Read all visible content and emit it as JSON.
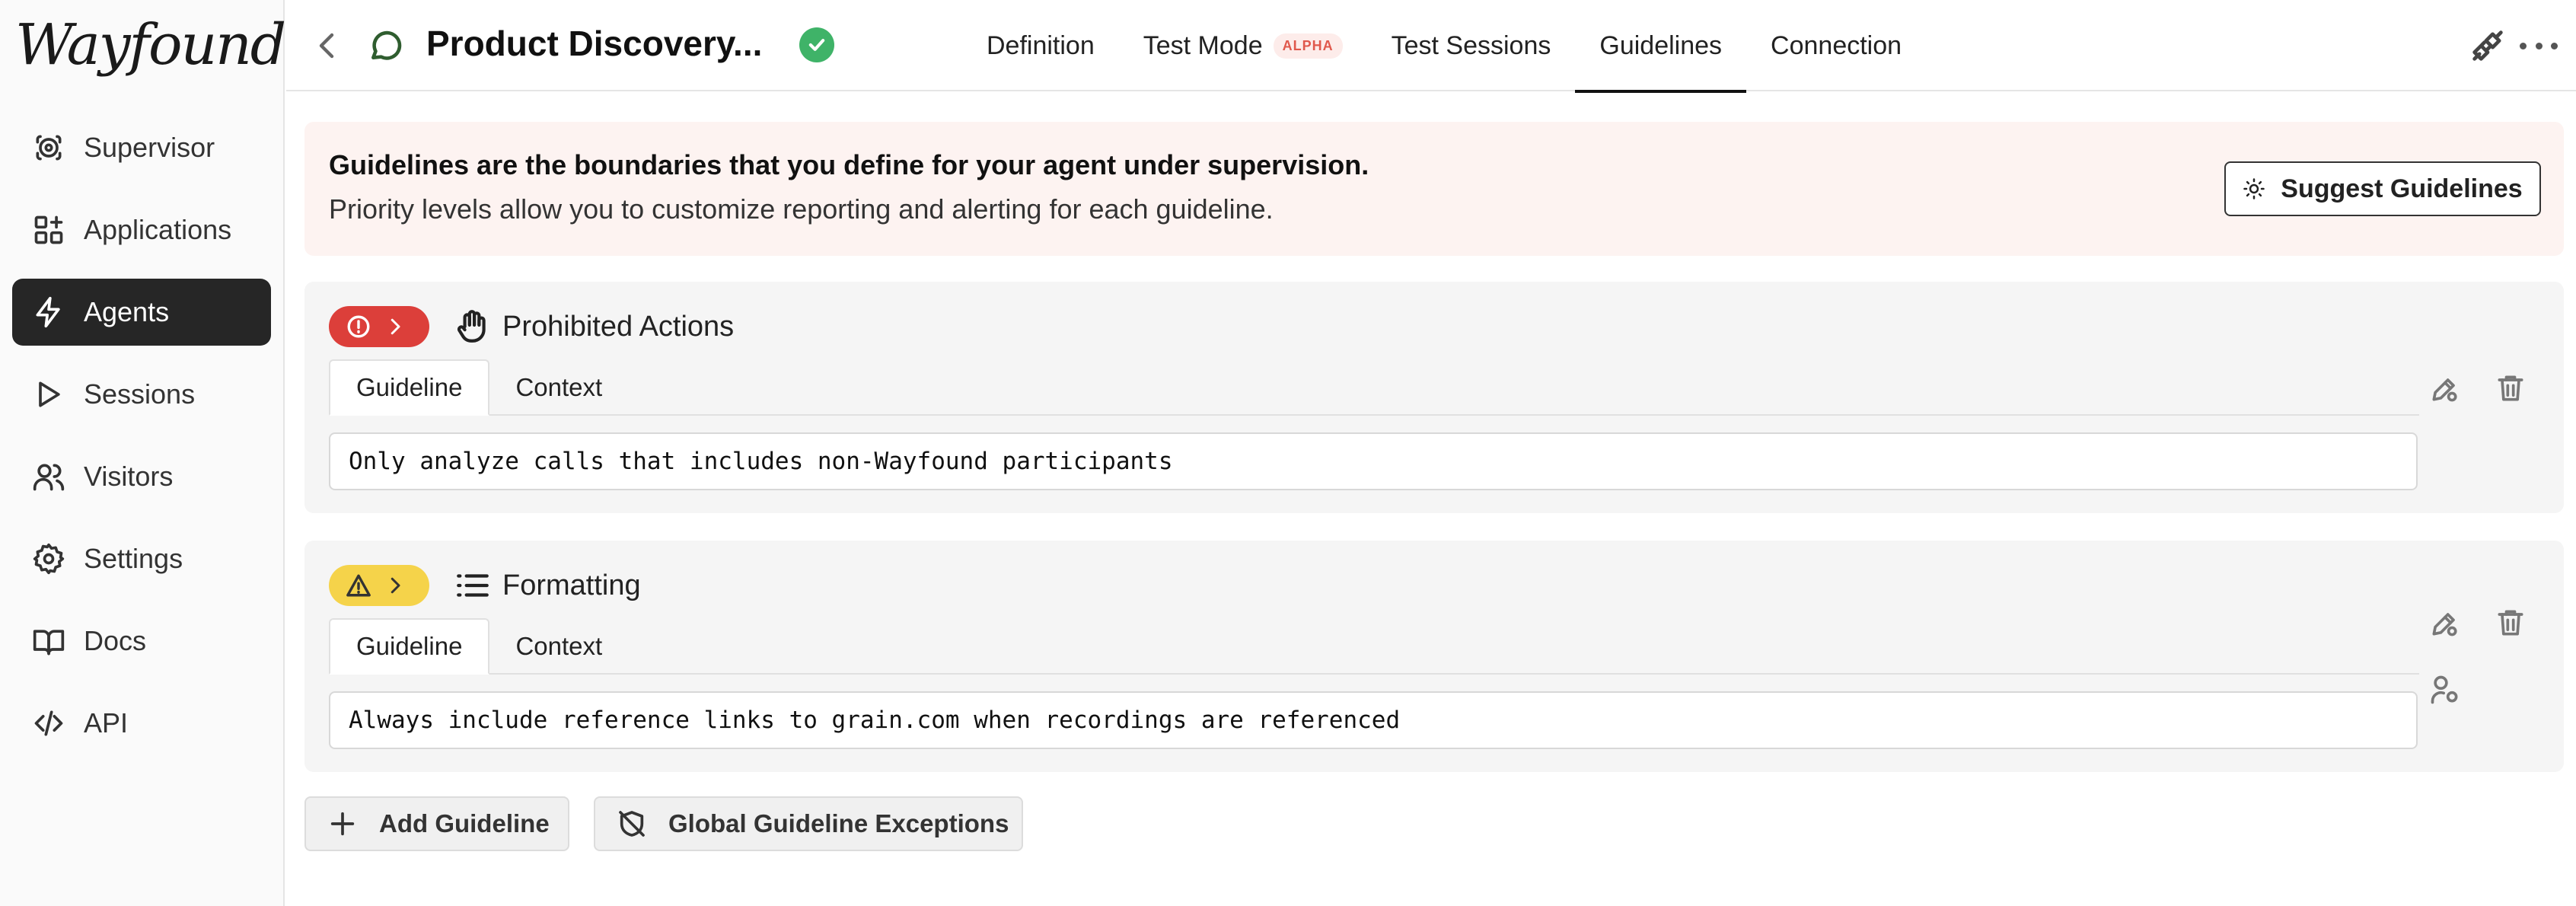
{
  "app": {
    "logo_text": "Wayfound"
  },
  "sidebar": {
    "items": [
      {
        "label": "Supervisor",
        "icon": "supervisor-icon",
        "active": false
      },
      {
        "label": "Applications",
        "icon": "applications-icon",
        "active": false
      },
      {
        "label": "Agents",
        "icon": "lightning-icon",
        "active": true
      },
      {
        "label": "Sessions",
        "icon": "play-icon",
        "active": false
      },
      {
        "label": "Visitors",
        "icon": "users-icon",
        "active": false
      },
      {
        "label": "Settings",
        "icon": "gear-icon",
        "active": false
      },
      {
        "label": "Docs",
        "icon": "book-icon",
        "active": false
      },
      {
        "label": "API",
        "icon": "code-icon",
        "active": false
      }
    ]
  },
  "header": {
    "agent_title": "Product Discovery...",
    "status": "verified",
    "tabs": [
      {
        "label": "Definition",
        "active": false
      },
      {
        "label": "Test Mode",
        "badge": "ALPHA",
        "active": false
      },
      {
        "label": "Test Sessions",
        "active": false
      },
      {
        "label": "Guidelines",
        "active": true
      },
      {
        "label": "Connection",
        "active": false
      }
    ]
  },
  "banner": {
    "title": "Guidelines are the boundaries that you define for your agent under supervision.",
    "subtitle": "Priority levels allow you to customize reporting and alerting for each guideline.",
    "suggest_button": "Suggest Guidelines"
  },
  "guidelines": [
    {
      "priority": "critical",
      "priority_color": "#dc3f3a",
      "category_icon": "hand-icon",
      "category": "Prohibited Actions",
      "tabs": [
        "Guideline",
        "Context"
      ],
      "active_tab": "Guideline",
      "text": "Only analyze calls that includes non-Wayfound participants"
    },
    {
      "priority": "warning",
      "priority_color": "#f5d34a",
      "category_icon": "list-icon",
      "category": "Formatting",
      "tabs": [
        "Guideline",
        "Context"
      ],
      "active_tab": "Guideline",
      "text": "Always include reference links to grain.com when recordings are referenced"
    }
  ],
  "actions": {
    "add_guideline": "Add Guideline",
    "global_exceptions": "Global Guideline Exceptions"
  }
}
